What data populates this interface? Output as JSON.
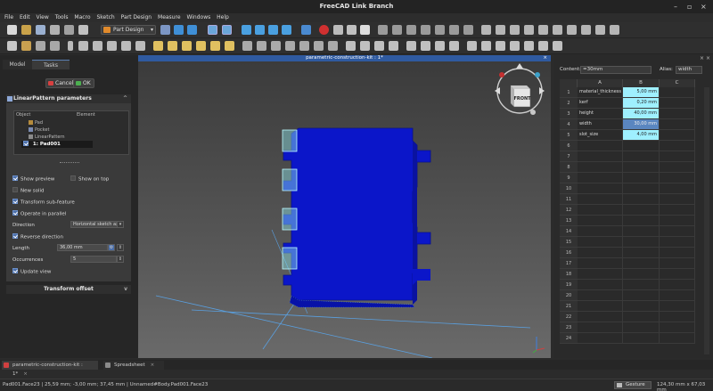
{
  "window": {
    "title": "FreeCAD Link Branch"
  },
  "menu": [
    "File",
    "Edit",
    "View",
    "Tools",
    "Macro",
    "Sketch",
    "Part Design",
    "Measure",
    "Windows",
    "Help"
  ],
  "toolbar": {
    "workbench": "Part Design"
  },
  "left_panel": {
    "tabs": [
      "Model",
      "Tasks"
    ],
    "cancel_label": "Cancel",
    "ok_label": "OK",
    "params_title": "LinearPattern parameters",
    "transform_title": "Transform offset",
    "list_headers": [
      "Object",
      "Element"
    ],
    "features": [
      "Pad",
      "Pocket",
      "LinearPattern"
    ],
    "selected_feature": "1: Pad001",
    "show_preview": "Show preview",
    "show_on_top": "Show on top",
    "new_solid": "New solid",
    "transform_subfeature": "Transform sub-feature",
    "operate_parallel": "Operate in parallel",
    "direction_label": "Direction",
    "direction_value": "Horizontal sketch axis",
    "reverse_direction": "Reverse direction",
    "length_label": "Length",
    "length_value": "36,00 mm",
    "occurrences_label": "Occurrences",
    "occurrences_value": "5",
    "update_view": "Update view"
  },
  "view": {
    "header": "parametric-construction-kit : 1*"
  },
  "spreadsheet": {
    "content_label": "Content:",
    "content_value": "=30mm",
    "alias_label": "Alias:",
    "alias_value": "width",
    "columns": [
      "A",
      "B",
      "C"
    ],
    "rows": [
      {
        "n": "1",
        "a": "material_thickness",
        "b": "5,00 mm"
      },
      {
        "n": "2",
        "a": "kerf",
        "b": "0,20 mm"
      },
      {
        "n": "3",
        "a": "height",
        "b": "40,00 mm"
      },
      {
        "n": "4",
        "a": "width",
        "b": "30,00 mm"
      },
      {
        "n": "5",
        "a": "slot_size",
        "b": "4,00 mm"
      },
      {
        "n": "6",
        "a": "",
        "b": ""
      },
      {
        "n": "7",
        "a": "",
        "b": ""
      },
      {
        "n": "8",
        "a": "",
        "b": ""
      },
      {
        "n": "9",
        "a": "",
        "b": ""
      },
      {
        "n": "10",
        "a": "",
        "b": ""
      },
      {
        "n": "11",
        "a": "",
        "b": ""
      },
      {
        "n": "12",
        "a": "",
        "b": ""
      },
      {
        "n": "13",
        "a": "",
        "b": ""
      },
      {
        "n": "14",
        "a": "",
        "b": ""
      },
      {
        "n": "15",
        "a": "",
        "b": ""
      },
      {
        "n": "16",
        "a": "",
        "b": ""
      },
      {
        "n": "17",
        "a": "",
        "b": ""
      },
      {
        "n": "18",
        "a": "",
        "b": ""
      },
      {
        "n": "19",
        "a": "",
        "b": ""
      },
      {
        "n": "20",
        "a": "",
        "b": ""
      },
      {
        "n": "21",
        "a": "",
        "b": ""
      },
      {
        "n": "22",
        "a": "",
        "b": ""
      },
      {
        "n": "23",
        "a": "",
        "b": ""
      },
      {
        "n": "24",
        "a": "",
        "b": ""
      }
    ]
  },
  "doc_tabs": [
    "parametric-construction-kit : 1*",
    "Spreadsheet"
  ],
  "status": {
    "text": "Pad001.Face23 | 25,59 mm; -3,00 mm; 37,45 mm | Unnamed#Body.Pad001.Face23",
    "gesture": "Gesture",
    "dims": "124,30 mm x 67,03 mm"
  },
  "navcube": {
    "face": "FRONT"
  }
}
